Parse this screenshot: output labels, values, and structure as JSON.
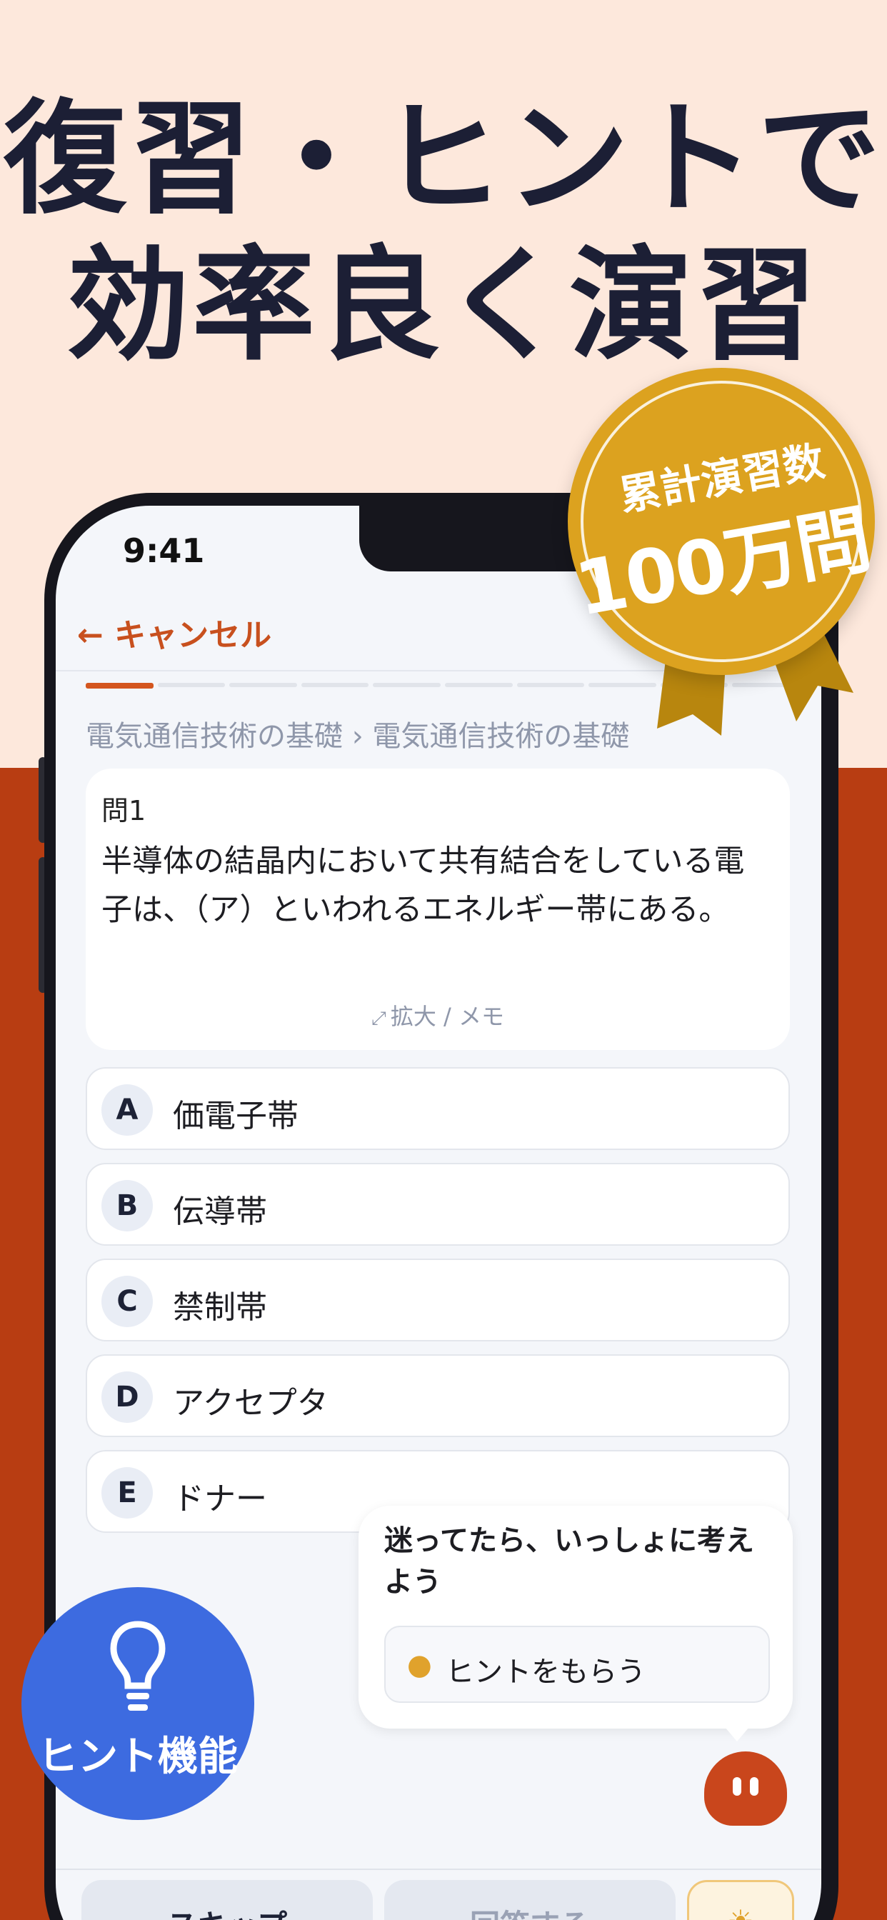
{
  "headline": {
    "line1": "復習・ヒントで",
    "line2": "効率良く演習"
  },
  "medal": {
    "line1": "累計演習数",
    "line2": "100万問"
  },
  "status_bar": {
    "time": "9:41"
  },
  "nav": {
    "cancel_label": "← キャンセル"
  },
  "progress": {
    "total_segments": 10,
    "current": 1
  },
  "breadcrumb": "電気通信技術の基礎 › 電気通信技術の基礎",
  "question": {
    "number": "問1",
    "text": "半導体の結晶内において共有結合をしている電子は、（ア）といわれるエネルギー帯にある。",
    "expand_label": "拡大 / メモ",
    "expand_icon": "expand-icon"
  },
  "options": [
    {
      "letter": "A",
      "text": "価電子帯"
    },
    {
      "letter": "B",
      "text": "伝導帯"
    },
    {
      "letter": "C",
      "text": "禁制帯"
    },
    {
      "letter": "D",
      "text": "アクセプタ"
    },
    {
      "letter": "E",
      "text": "ドナー"
    }
  ],
  "hint_bubble": {
    "title": "迷ってたら、いっしょに考えよう",
    "button_label": "ヒントをもらう",
    "button_icon": "lightbulb-icon"
  },
  "footer": {
    "skip_label": "スキップ",
    "answer_label": "回答する"
  },
  "hint_badge": {
    "label": "ヒント機能",
    "icon": "lightbulb-icon"
  },
  "colors": {
    "accent": "#c8501e",
    "background_top": "#fde8dc",
    "background_bottom": "#b83d12",
    "medal": "#dca21f",
    "hint_badge": "#3d6be0"
  }
}
